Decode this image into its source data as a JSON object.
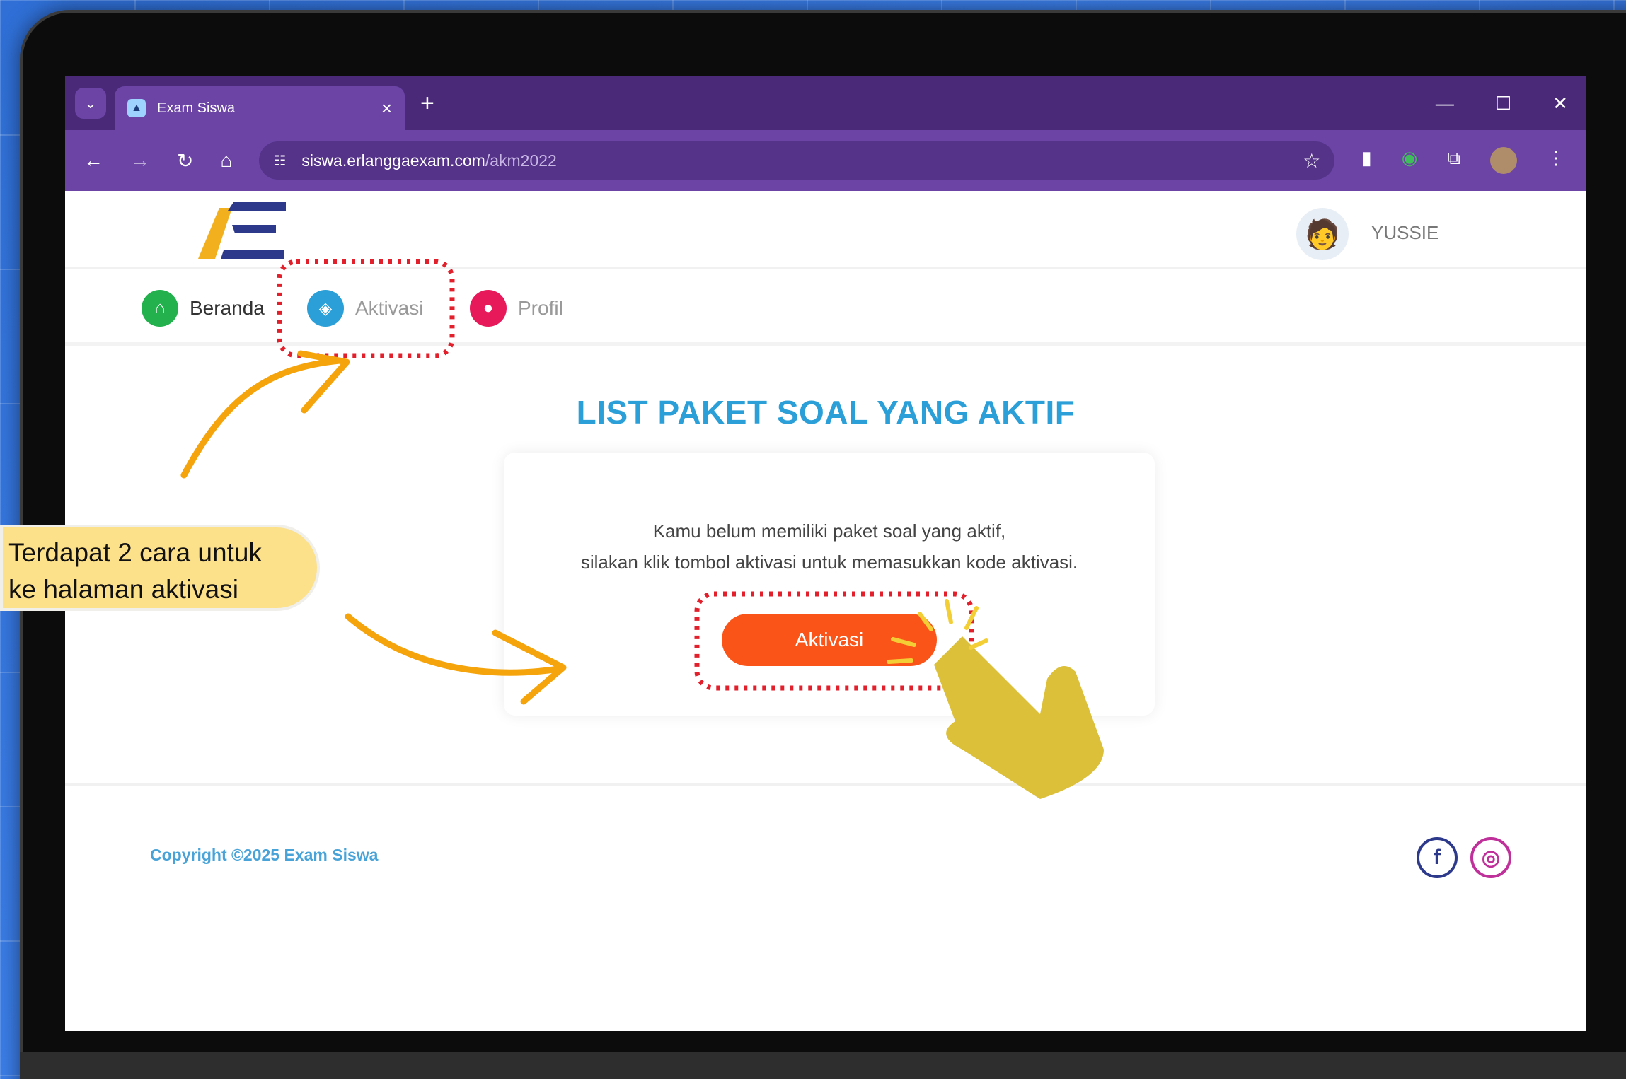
{
  "browser": {
    "tab_title": "Exam Siswa",
    "url_host": "siswa.erlanggaexam.com",
    "url_path": "/akm2022"
  },
  "header": {
    "user_name": "YUSSIE"
  },
  "nav": {
    "items": [
      {
        "label": "Beranda",
        "icon": "home-icon",
        "color": "#22b14c"
      },
      {
        "label": "Aktivasi",
        "icon": "tag-icon",
        "color": "#2a9fd8"
      },
      {
        "label": "Profil",
        "icon": "user-icon",
        "color": "#e8195a"
      }
    ]
  },
  "main": {
    "title": "LIST PAKET SOAL YANG AKTIF",
    "message_line1": "Kamu belum memiliki paket soal yang aktif,",
    "message_line2": "silakan klik tombol aktivasi untuk memasukkan kode aktivasi.",
    "button_label": "Aktivasi",
    "button_color": "#fb5418"
  },
  "footer": {
    "copyright": "Copyright ©2025 Exam Siswa",
    "socials": [
      "facebook-icon",
      "instagram-icon"
    ]
  },
  "annotation": {
    "line1": "Terdapat 2 cara untuk",
    "line2": "ke halaman aktivasi",
    "highlight_color": "#e2202c",
    "arrow_color": "#f5a40c"
  }
}
